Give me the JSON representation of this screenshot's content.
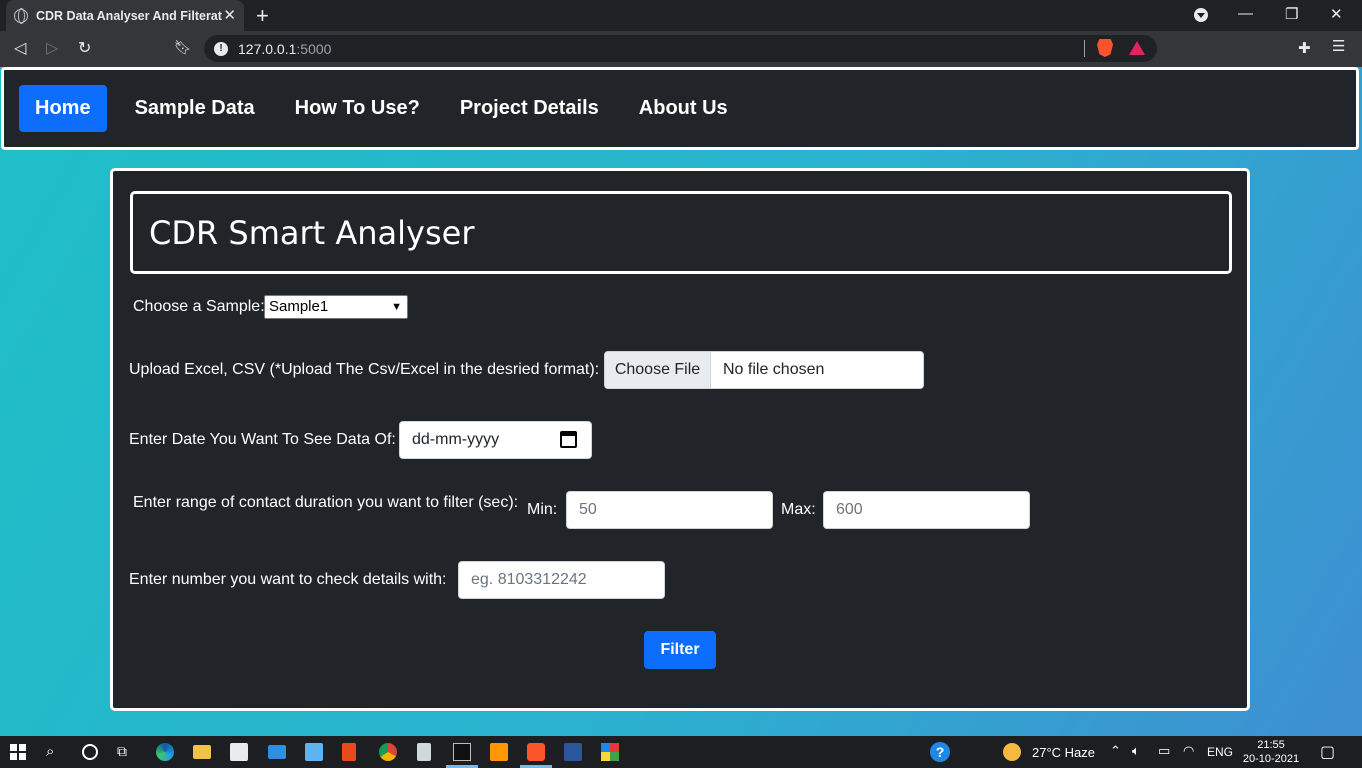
{
  "browser": {
    "tab_title": "CDR Data Analyser And Filteration",
    "url_host": "127.0.0.1",
    "url_port": ":5000"
  },
  "navbar": {
    "items": [
      "Home",
      "Sample Data",
      "How To Use?",
      "Project Details",
      "About Us"
    ],
    "active": "Home"
  },
  "card": {
    "heading": "CDR Smart Analyser",
    "sample": {
      "label": "Choose a Sample:",
      "selected": "Sample1"
    },
    "upload": {
      "label": "Upload Excel, CSV (*Upload The Csv/Excel in the desried format):",
      "button": "Choose File",
      "status": "No file chosen"
    },
    "date": {
      "label": "Enter Date You Want To See Data Of:",
      "placeholder": "dd-mm-yyyy"
    },
    "duration": {
      "label": "Enter range of contact duration you want to filter (sec):",
      "min_label": "Min:",
      "min_placeholder": "50",
      "max_label": "Max:",
      "max_placeholder": "600"
    },
    "number": {
      "label": "Enter number you want to check details with:",
      "placeholder": "eg. 8103312242"
    },
    "filter_button": "Filter"
  },
  "taskbar": {
    "weather": "27°C  Haze",
    "lang": "ENG",
    "time": "21:55",
    "date": "20-10-2021"
  }
}
